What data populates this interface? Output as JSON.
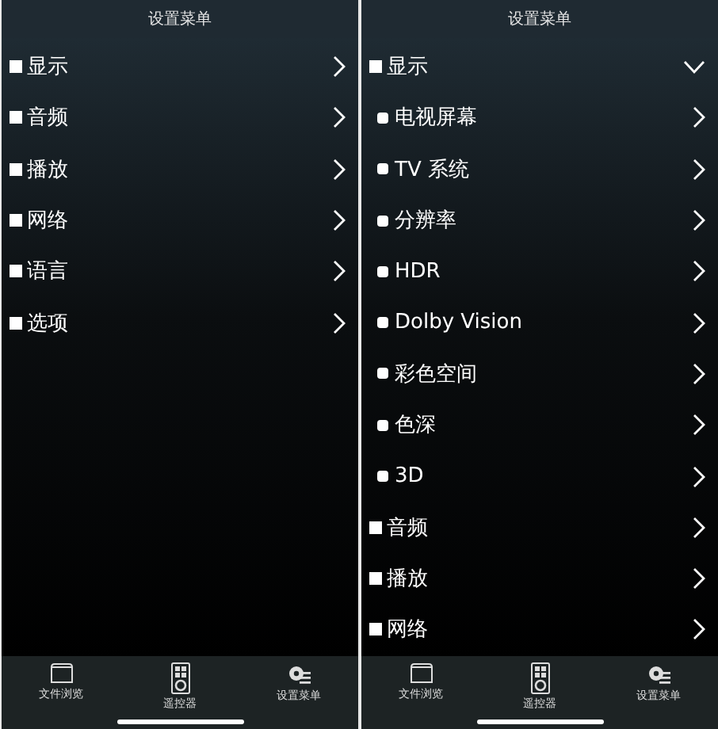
{
  "panels": [
    {
      "title": "设置菜单",
      "items": [
        {
          "label": "显示",
          "expanded": false
        },
        {
          "label": "音频",
          "expanded": false
        },
        {
          "label": "播放",
          "expanded": false
        },
        {
          "label": "网络",
          "expanded": false
        },
        {
          "label": "语言",
          "expanded": false
        },
        {
          "label": "选项",
          "expanded": false
        }
      ],
      "tabs": [
        {
          "label": "文件浏览",
          "kind": "folder"
        },
        {
          "label": "遥控器",
          "kind": "remote"
        },
        {
          "label": "设置菜单",
          "kind": "settings"
        }
      ]
    },
    {
      "title": "设置菜单",
      "items": [
        {
          "label": "显示",
          "expanded": true,
          "children": [
            {
              "label": "电视屏幕"
            },
            {
              "label": "TV 系统"
            },
            {
              "label": "分辨率"
            },
            {
              "label": "HDR"
            },
            {
              "label": "Dolby Vision"
            },
            {
              "label": "彩色空间"
            },
            {
              "label": "色深"
            },
            {
              "label": "3D"
            }
          ]
        },
        {
          "label": "音频",
          "expanded": false
        },
        {
          "label": "播放",
          "expanded": false
        },
        {
          "label": "网络",
          "expanded": false
        }
      ],
      "tabs": [
        {
          "label": "文件浏览",
          "kind": "folder"
        },
        {
          "label": "遥控器",
          "kind": "remote"
        },
        {
          "label": "设置菜单",
          "kind": "settings"
        }
      ]
    }
  ]
}
